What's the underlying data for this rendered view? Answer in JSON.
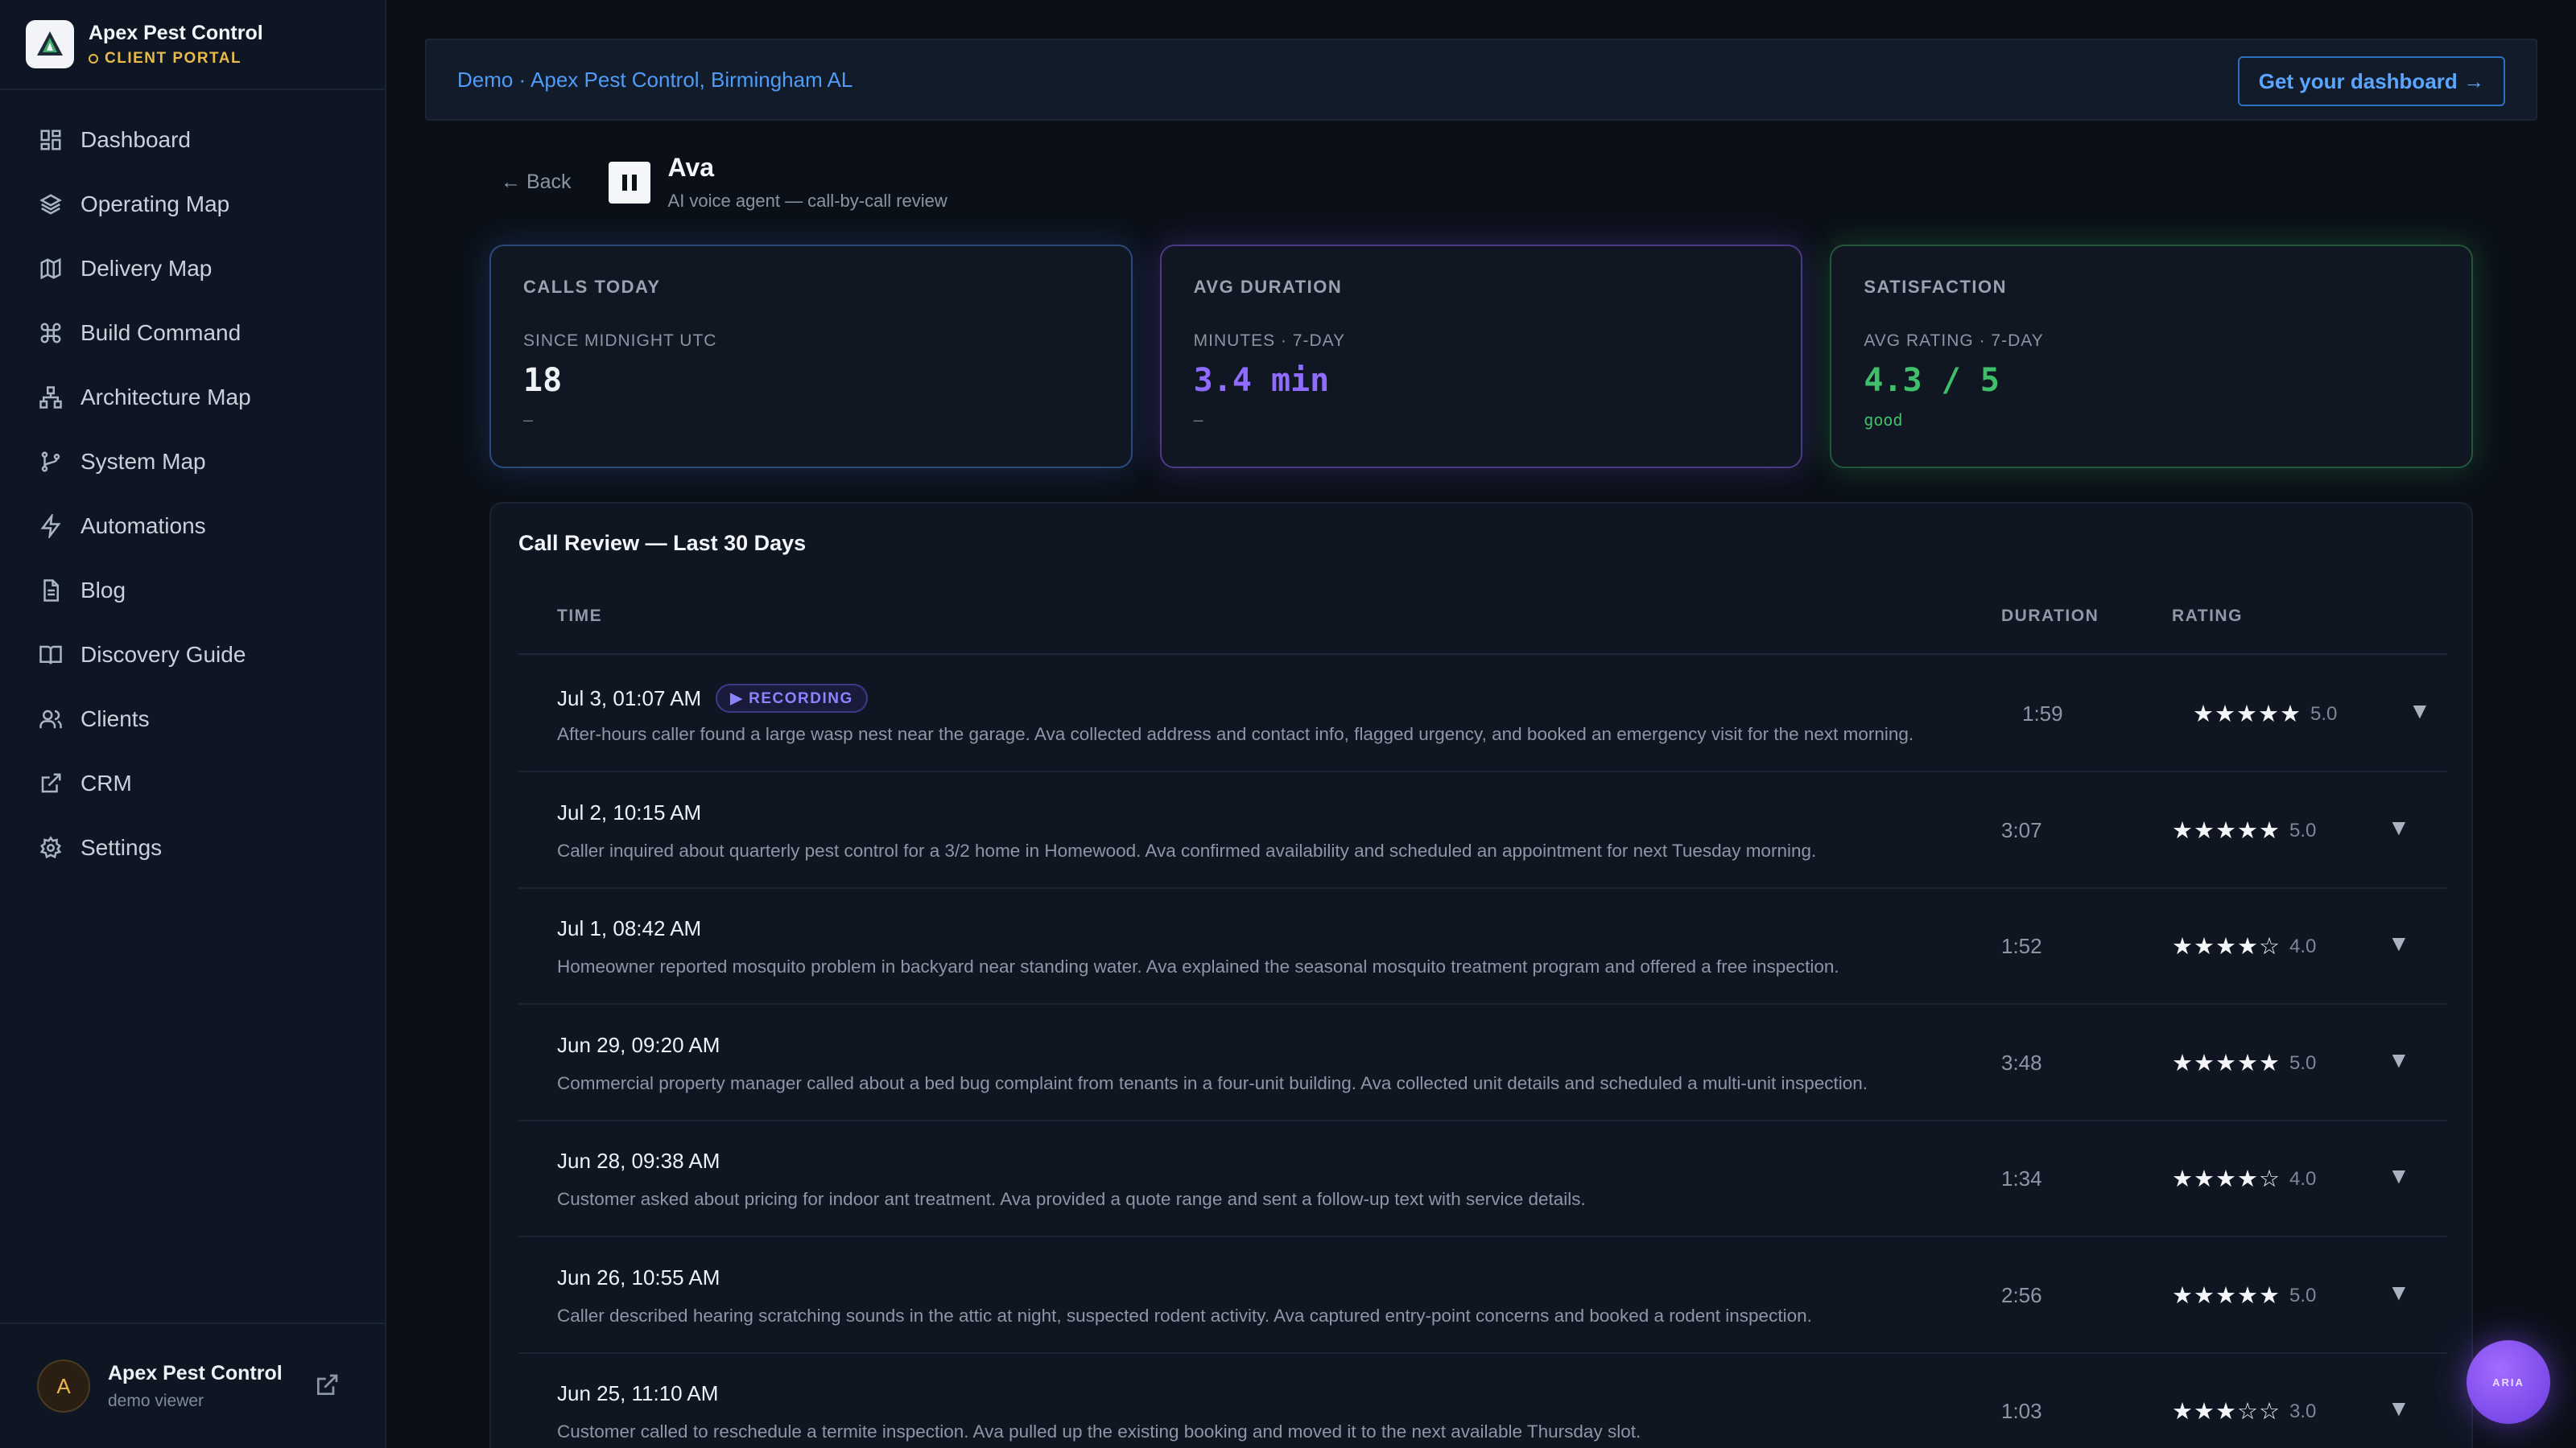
{
  "brand": {
    "name": "Apex Pest Control",
    "portal_label": "CLIENT PORTAL"
  },
  "nav": [
    {
      "label": "Dashboard",
      "icon": "grid-icon"
    },
    {
      "label": "Operating Map",
      "icon": "layers-icon"
    },
    {
      "label": "Delivery Map",
      "icon": "map-icon"
    },
    {
      "label": "Build Command",
      "icon": "command-icon"
    },
    {
      "label": "Architecture Map",
      "icon": "hierarchy-icon"
    },
    {
      "label": "System Map",
      "icon": "branch-icon"
    },
    {
      "label": "Automations",
      "icon": "lightning-icon"
    },
    {
      "label": "Blog",
      "icon": "document-icon"
    },
    {
      "label": "Discovery Guide",
      "icon": "book-icon"
    },
    {
      "label": "Clients",
      "icon": "users-icon"
    },
    {
      "label": "CRM",
      "icon": "external-link-icon"
    },
    {
      "label": "Settings",
      "icon": "gear-icon"
    }
  ],
  "user": {
    "initial": "A",
    "name": "Apex Pest Control",
    "role": "demo viewer"
  },
  "banner": {
    "text": "Demo · Apex Pest Control, Birmingham AL",
    "cta": "Get your dashboard →"
  },
  "header": {
    "back": "← Back",
    "agent_name": "Ava",
    "agent_sub": "AI voice agent — call-by-call review"
  },
  "stats": [
    {
      "label": "CALLS TODAY",
      "sub": "SINCE MIDNIGHT UTC",
      "value": "18",
      "note": "—",
      "value_color": "#eef2f7",
      "note_color": "#6e7888"
    },
    {
      "label": "AVG DURATION",
      "sub": "MINUTES · 7-DAY",
      "value": "3.4 min",
      "note": "—",
      "value_color": "#8f6bff",
      "note_color": "#6e7888"
    },
    {
      "label": "SATISFACTION",
      "sub": "AVG RATING · 7-DAY",
      "value": "4.3 / 5",
      "note": "good",
      "value_color": "#3fbf6a",
      "note_color": "#3fbf6a"
    }
  ],
  "review": {
    "title": "Call Review — Last 30 Days",
    "columns": {
      "time": "TIME",
      "duration": "DURATION",
      "rating": "RATING"
    },
    "recording_badge": "▶ RECORDING",
    "rows": [
      {
        "time": "Jul 3, 01:07 AM",
        "recording": true,
        "desc": "After-hours caller found a large wasp nest near the garage. Ava collected address and contact info, flagged urgency, and booked an emergency visit for the next morning.",
        "duration": "1:59",
        "stars": "★★★★★",
        "rating": "5.0",
        "rating_value": 5
      },
      {
        "time": "Jul 2, 10:15 AM",
        "recording": false,
        "desc": "Caller inquired about quarterly pest control for a 3/2 home in Homewood. Ava confirmed availability and scheduled an appointment for next Tuesday morning.",
        "duration": "3:07",
        "stars": "★★★★★",
        "rating": "5.0",
        "rating_value": 5
      },
      {
        "time": "Jul 1, 08:42 AM",
        "recording": false,
        "desc": "Homeowner reported mosquito problem in backyard near standing water. Ava explained the seasonal mosquito treatment program and offered a free inspection.",
        "duration": "1:52",
        "stars": "★★★★☆",
        "rating": "4.0",
        "rating_value": 4
      },
      {
        "time": "Jun 29, 09:20 AM",
        "recording": false,
        "desc": "Commercial property manager called about a bed bug complaint from tenants in a four-unit building. Ava collected unit details and scheduled a multi-unit inspection.",
        "duration": "3:48",
        "stars": "★★★★★",
        "rating": "5.0",
        "rating_value": 5
      },
      {
        "time": "Jun 28, 09:38 AM",
        "recording": false,
        "desc": "Customer asked about pricing for indoor ant treatment. Ava provided a quote range and sent a follow-up text with service details.",
        "duration": "1:34",
        "stars": "★★★★☆",
        "rating": "4.0",
        "rating_value": 4
      },
      {
        "time": "Jun 26, 10:55 AM",
        "recording": false,
        "desc": "Caller described hearing scratching sounds in the attic at night, suspected rodent activity. Ava captured entry-point concerns and booked a rodent inspection.",
        "duration": "2:56",
        "stars": "★★★★★",
        "rating": "5.0",
        "rating_value": 5
      },
      {
        "time": "Jun 25, 11:10 AM",
        "recording": false,
        "desc": "Customer called to reschedule a termite inspection. Ava pulled up the existing booking and moved it to the next available Thursday slot.",
        "duration": "1:03",
        "stars": "★★★☆☆",
        "rating": "3.0",
        "rating_value": 3
      }
    ]
  },
  "assistant_bubble": "ARIA",
  "colors": {
    "accent_blue": "#4f9bf5",
    "accent_purple": "#8f6bff",
    "accent_green": "#3fbf6a",
    "brand_gold": "#e9b949"
  }
}
